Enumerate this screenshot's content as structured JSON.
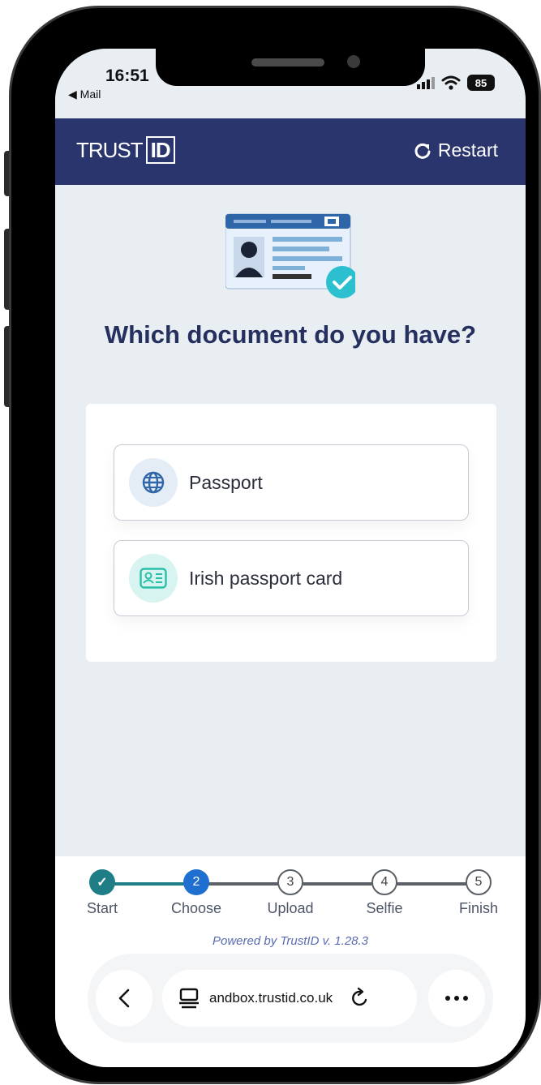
{
  "status_bar": {
    "time": "16:51",
    "back_app": "◀ Mail",
    "battery": "85"
  },
  "header": {
    "logo_trust": "TRUST",
    "logo_id": "ID",
    "restart_label": "Restart"
  },
  "main": {
    "title": "Which document do you have?"
  },
  "options": [
    {
      "label": "Passport",
      "icon": "globe-icon"
    },
    {
      "label": "Irish passport card",
      "icon": "id-card-icon"
    }
  ],
  "steps": [
    {
      "number": "✓",
      "label": "Start",
      "state": "done"
    },
    {
      "number": "2",
      "label": "Choose",
      "state": "current"
    },
    {
      "number": "3",
      "label": "Upload",
      "state": "todo"
    },
    {
      "number": "4",
      "label": "Selfie",
      "state": "todo"
    },
    {
      "number": "5",
      "label": "Finish",
      "state": "todo"
    }
  ],
  "footer": {
    "powered": "Powered by TrustID v. 1.28.3"
  },
  "browser": {
    "url": "andbox.trustid.co.uk"
  },
  "colors": {
    "brand_navy": "#2b356d",
    "step_done": "#1f7d86",
    "step_current": "#1f6fd1",
    "accent_teal": "#2bbfcf"
  }
}
